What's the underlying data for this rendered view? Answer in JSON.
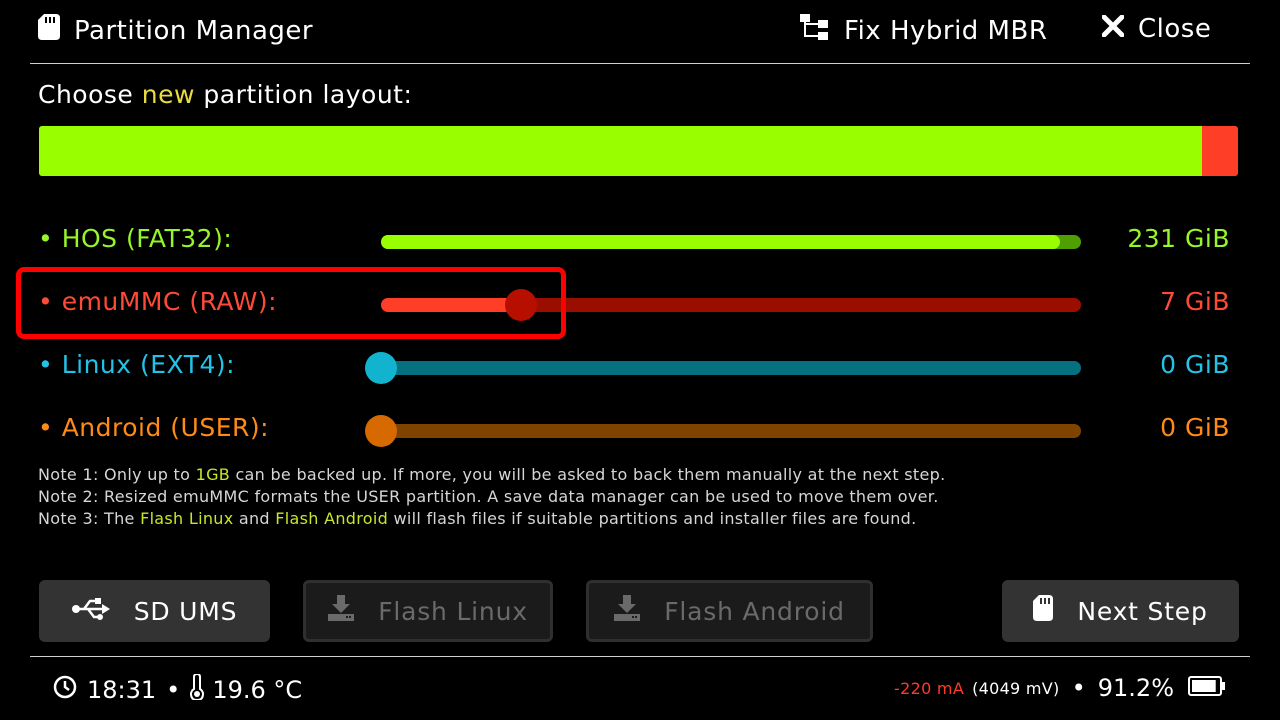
{
  "header": {
    "title": "Partition Manager",
    "fix_mbr_label": "Fix Hybrid MBR",
    "close_label": "Close",
    "title_icon": "sd-card-icon",
    "fix_mbr_icon": "sitemap-icon",
    "close_icon": "close-icon"
  },
  "layout_heading": {
    "prefix": "Choose",
    "highlight": "new",
    "suffix": "partition layout:"
  },
  "overview_bar": {
    "segments": [
      {
        "name": "HOS",
        "fraction": 0.97,
        "color": "#99ff00"
      },
      {
        "name": "emuMMC",
        "fraction": 0.03,
        "color": "#ff3e28"
      }
    ]
  },
  "partitions": [
    {
      "label": "• HOS (FAT32):",
      "value": "231 GiB",
      "label_color": "#96f62a",
      "value_color": "#96f62a",
      "track_color": "#4f9f00",
      "fill_color": "#99ff00",
      "knob_color": "",
      "fraction": 0.97
    },
    {
      "label": "• emuMMC (RAW):",
      "value": "7 GiB",
      "label_color": "#ff4a37",
      "value_color": "#ff4a37",
      "track_color": "#9a0e00",
      "fill_color": "#ff3e28",
      "knob_color": "#b60f00",
      "fraction": 0.2
    },
    {
      "label": "• Linux (EXT4):",
      "value": "0 GiB",
      "label_color": "#23c3e8",
      "value_color": "#23c3e8",
      "track_color": "#05707f",
      "fill_color": "#05707f",
      "knob_color": "#12b3cf",
      "fraction": 0.0
    },
    {
      "label": "• Android (USER):",
      "value": "0 GiB",
      "label_color": "#ff8a16",
      "value_color": "#ff8a16",
      "track_color": "#7f4300",
      "fill_color": "#7f4300",
      "knob_color": "#d66a00",
      "fraction": 0.0
    }
  ],
  "notes": {
    "n1_a": "Note 1: Only up to ",
    "n1_hl": "1GB",
    "n1_b": " can be backed up. If more, you will be asked to back them manually at the next step.",
    "n2": "Note 2: Resized emuMMC formats the USER partition. A save data manager can be used to move them over.",
    "n3_a": "Note 3: The ",
    "n3_hl1": "Flash Linux",
    "n3_b": " and ",
    "n3_hl2": "Flash Android",
    "n3_c": " will flash files if suitable partitions and installer files are found."
  },
  "buttons": {
    "sd_ums": {
      "label": "SD UMS",
      "icon": "usb-icon",
      "enabled": true
    },
    "flash_linux": {
      "label": "Flash Linux",
      "icon": "download-icon",
      "enabled": false
    },
    "flash_android": {
      "label": "Flash Android",
      "icon": "download-icon",
      "enabled": false
    },
    "next_step": {
      "label": "Next Step",
      "icon": "sd-card-icon",
      "enabled": true
    }
  },
  "status": {
    "time": "18:31",
    "temperature": "19.6 °C",
    "current": "-220 mA",
    "voltage": "(4049 mV)",
    "battery": "91.2%",
    "battery_fraction": 0.912,
    "current_color": "#ff3a2a"
  }
}
